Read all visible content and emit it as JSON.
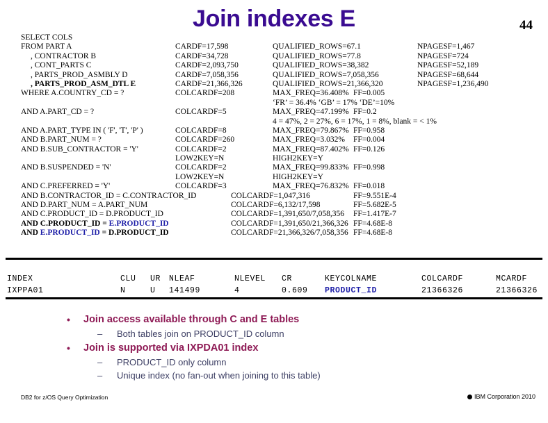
{
  "slide": {
    "title": "Join indexes E",
    "page_number": "44",
    "title_color": "#3A0B91",
    "accent_magenta": "#8E1A55",
    "accent_navy": "#3D3F64",
    "accent_blue": "#1F20A8"
  },
  "sql_block": {
    "rows": [
      {
        "c1": "SELECT COLS",
        "c2": "",
        "c3": "",
        "c4": ""
      },
      {
        "c1": "FROM PART  A",
        "c2": "CARDF=17,598",
        "c3": "QUALIFIED_ROWS=67.1",
        "c4": "NPAGESF=1,467"
      },
      {
        "c1": ", CONTRACTOR B",
        "indent": true,
        "c2": "CARDF=34,728",
        "c3": "QUALIFIED_ROWS=77.8",
        "c4": "NPAGESF=724"
      },
      {
        "c1": ", CONT_PARTS C",
        "indent": true,
        "c2": "CARDF=2,093,750",
        "c3": "QUALIFIED_ROWS=38,382",
        "c4": "NPAGESF=52,189"
      },
      {
        "c1": ", PARTS_PROD_ASMBLY D",
        "indent": true,
        "c2": "CARDF=7,058,356",
        "c3": "QUALIFIED_ROWS=7,058,356",
        "c4": "NPAGESF=68,644"
      },
      {
        "c1": ", PARTS_PROD_ASM_DTL E",
        "indent": true,
        "bold": true,
        "c2": "CARDF=21,366,326",
        "c3": "QUALIFIED_ROWS=21,366,320",
        "c4": "NPAGESF=1,236,490"
      },
      {
        "c1": "WHERE A.COUNTRY_CD = ?",
        "c2": "COLCARDF=208",
        "c3": "MAX_FREQ=36.408%",
        "ff": "FF=0.005"
      },
      {
        "c1": "",
        "c2": "",
        "c3": "‘FR’ = 36.4%   ‘GB’ = 17%    ‘DE’=10%"
      },
      {
        "c1": "AND A.PART_CD = ?",
        "c2": "COLCARDF=5",
        "c3": "MAX_FREQ=47.199%",
        "ff": "FF=0.2"
      },
      {
        "c1": "",
        "c2": "",
        "c3": "4 = 47%, 2 = 27%, 6 = 17%, 1 = 8%, blank = < 1%"
      },
      {
        "c1": "AND A.PART_TYPE IN ( 'F', 'T', 'P' )",
        "c2": "COLCARDF=8",
        "c3": "MAX_FREQ=79.867%",
        "ff": "FF=0.958"
      },
      {
        "c1": "AND B.PART_NUM = ?",
        "c2": "COLCARDF=260",
        "c3": "MAX_FREQ=3.032%",
        "ff": "FF=0.004"
      },
      {
        "c1": "AND B.SUB_CONTRACTOR = 'Y'",
        "c2": "COLCARDF=2",
        "c3": "MAX_FREQ=87.402%",
        "ff": "FF=0.126"
      },
      {
        "c1": "",
        "c2": "LOW2KEY=N",
        "c3": "HIGH2KEY=Y"
      },
      {
        "c1": "AND B.SUSPENDED = 'N'",
        "c2": "COLCARDF=2",
        "c3": "MAX_FREQ=99.833%",
        "ff": "FF=0.998"
      },
      {
        "c1": "",
        "c2": "LOW2KEY=N",
        "c3": "HIGH2KEY=Y"
      },
      {
        "c1": "AND C.PREFERRED = 'Y'",
        "c2": "COLCARDF=3",
        "c3": "MAX_FREQ=76.832%",
        "ff": "FF=0.018"
      },
      {
        "c1": "AND B.CONTRACTOR_ID = C.CONTRACTOR_ID",
        "wide": true,
        "c2": "COLCARDF=1,047,316",
        "ff": "FF=9.551E-4"
      },
      {
        "c1": "AND D.PART_NUM = A.PART_NUM",
        "wide": true,
        "c2": "COLCARDF=6,132/17,598",
        "ff": "FF=5.682E-5"
      },
      {
        "c1": "AND C.PRODUCT_ID = D.PRODUCT_ID",
        "wide": true,
        "c2": "COLCARDF=1,391,650/7,058,356",
        "ff": "FF=1.417E-7"
      },
      {
        "c1": "AND C.PRODUCT_ID = E.PRODUCT_ID",
        "wide": true,
        "bold": true,
        "blue_tail": "E.PRODUCT_ID",
        "c2": "COLCARDF=1,391,650/21,366,326",
        "ff": "FF=4.68E-8"
      },
      {
        "c1": "AND E.PRODUCT_ID = D.PRODUCT_ID",
        "wide": true,
        "bold": true,
        "blue_mid": "E.PRODUCT_ID",
        "c2": "COLCARDF=21,366,326/7,058,356",
        "ff": "FF=4.68E-8"
      }
    ]
  },
  "index_table": {
    "headers": [
      "INDEX",
      "CLU",
      "UR",
      "NLEAF",
      "NLEVEL",
      "CR",
      "KEYCOLNAME",
      "COLCARDF",
      "MCARDF"
    ],
    "row": {
      "index": "IXPPA01",
      "clu": "N",
      "ur": "U",
      "nleaf": "141499",
      "nlevel": "4",
      "cr": "0.609",
      "keycolname": "PRODUCT_ID",
      "colcardf": "21366326",
      "mcardf": "21366326"
    }
  },
  "bullets": [
    {
      "level": 1,
      "mark": "•",
      "text": "Join access available through C and E tables"
    },
    {
      "level": 2,
      "mark": "–",
      "text": "Both tables join on PRODUCT_ID column"
    },
    {
      "level": 1,
      "mark": "•",
      "text": "Join is supported via IXPDA01 index"
    },
    {
      "level": 2,
      "mark": "–",
      "text": "PRODUCT_ID only column"
    },
    {
      "level": 2,
      "mark": "–",
      "text": "Unique index (no fan-out when joining to this table)"
    }
  ],
  "footer": {
    "left": "DB2 for z/OS Query Optimization",
    "right": "IBM Corporation 2010"
  }
}
